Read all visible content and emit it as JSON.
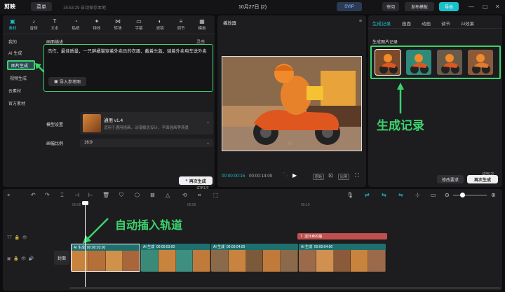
{
  "app": {
    "logo": "剪映",
    "menu": "菜单",
    "autosave": "15:53:29 自动保存本地",
    "title": "10月27日 (2)"
  },
  "topbar": {
    "svip": "SVIP",
    "share": "审阅",
    "template": "发布模板",
    "export": "导出"
  },
  "tools": [
    {
      "icon": "▣",
      "label": "素材"
    },
    {
      "icon": "♪",
      "label": "音频"
    },
    {
      "icon": "T",
      "label": "文本"
    },
    {
      "icon": "◔",
      "label": "贴纸"
    },
    {
      "icon": "✦",
      "label": "特效"
    },
    {
      "icon": "⋈",
      "label": "转场"
    },
    {
      "icon": "▭",
      "label": "字幕"
    },
    {
      "icon": "◐",
      "label": "滤镜"
    },
    {
      "icon": "≡",
      "label": "调节"
    },
    {
      "icon": "▦",
      "label": "模板"
    }
  ],
  "sidebar": {
    "mine": "我的",
    "ai": "AI 生成",
    "image_gen": "图片生成",
    "video_gen": "视频生成",
    "cloud": "云素材",
    "official": "官方素材"
  },
  "form": {
    "desc_label": "画面描述",
    "inspiration": "灵感",
    "prompt": "杰作，最佳质量，一只胖橘猫穿着外卖员的衣服，戴着头盔，骑着外卖电车送外卖",
    "ref_btn": "导入参考图",
    "model_label": "模型设置",
    "model_name": "通用 v1.4",
    "model_desc": "适用于通用插画，动漫概念设计，平面插画等场景",
    "ratio_label": "画幅比例",
    "ratio": "16:9",
    "trial": "试用1次",
    "regen": "再次生成"
  },
  "player": {
    "title": "播放器",
    "time_current": "00:00:00:15",
    "time_total": "00:00:14:00",
    "btn_orig": "原始",
    "btn_ratio": "比例"
  },
  "right": {
    "tabs": [
      "生成记录",
      "画面",
      "动画",
      "调节",
      "AI效果"
    ],
    "record_title": "生成图片记录",
    "big_label": "生成记录",
    "edit_req": "修改要求",
    "trial": "试用1次",
    "regen": "再次生成"
  },
  "timeline": {
    "ruler": [
      "00:00",
      "00:05",
      "00:10"
    ],
    "insert_label": "自动插入轨道",
    "text_clip": "送外卖的猫",
    "cover": "封面",
    "clips": [
      {
        "name": "AI 生成",
        "time": "00:00:03:00"
      },
      {
        "name": "AI 生成",
        "time": "00:00:03:00"
      },
      {
        "name": "AI 生成",
        "time": "00:00:04:00"
      },
      {
        "name": "AI 生成",
        "time": "00:00:04:00"
      }
    ]
  },
  "colors": {
    "accent": "#1bc1c9",
    "highlight": "#3bd36c"
  }
}
